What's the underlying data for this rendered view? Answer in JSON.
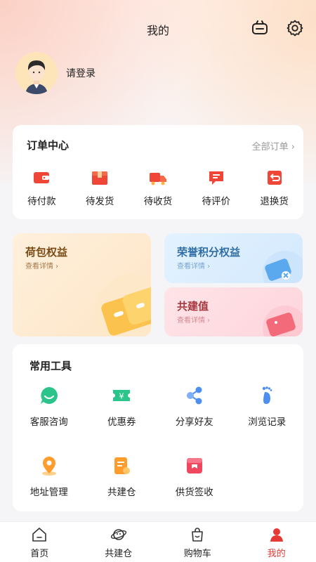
{
  "header": {
    "title": "我的"
  },
  "profile": {
    "login_label": "请登录"
  },
  "orders": {
    "title": "订单中心",
    "all_label": "全部订单",
    "items": [
      {
        "label": "待付款",
        "icon": "wallet-icon"
      },
      {
        "label": "待发货",
        "icon": "package-icon"
      },
      {
        "label": "待收货",
        "icon": "truck-icon"
      },
      {
        "label": "待评价",
        "icon": "comment-icon"
      },
      {
        "label": "退换货",
        "icon": "return-icon"
      }
    ]
  },
  "benefits": {
    "hebao": {
      "title": "荷包权益",
      "sub": "查看详情"
    },
    "rongyu": {
      "title": "荣誉积分权益",
      "sub": "查看详情"
    },
    "gongjian": {
      "title": "共建值",
      "sub": "查看详情"
    }
  },
  "tools": {
    "title": "常用工具",
    "items": [
      {
        "label": "客服咨询",
        "icon": "chat-icon"
      },
      {
        "label": "优惠券",
        "icon": "coupon-icon"
      },
      {
        "label": "分享好友",
        "icon": "share-icon"
      },
      {
        "label": "浏览记录",
        "icon": "footprint-icon"
      },
      {
        "label": "地址管理",
        "icon": "location-icon"
      },
      {
        "label": "共建仓",
        "icon": "document-icon"
      },
      {
        "label": "供货签收",
        "icon": "bag-icon"
      }
    ]
  },
  "tabbar": {
    "items": [
      {
        "label": "首页",
        "active": false
      },
      {
        "label": "共建仓",
        "active": false
      },
      {
        "label": "购物车",
        "active": false
      },
      {
        "label": "我的",
        "active": true
      }
    ]
  },
  "colors": {
    "accent": "#e53935",
    "background": "#f5f5f7"
  }
}
